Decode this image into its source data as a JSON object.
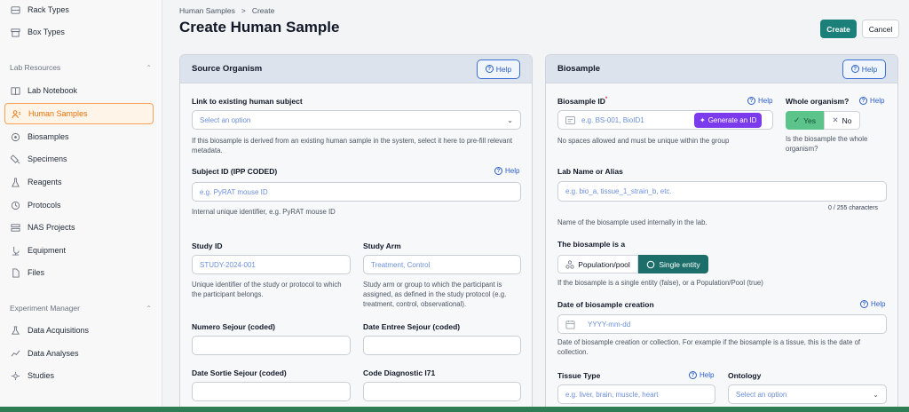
{
  "sidebar": {
    "items_top": [
      {
        "label": "Rack Types",
        "icon": "rack-icon"
      },
      {
        "label": "Box Types",
        "icon": "box-icon"
      }
    ],
    "section_lab": "Lab Resources",
    "lab_items": [
      {
        "label": "Lab Notebook",
        "icon": "book-icon"
      },
      {
        "label": "Human Samples",
        "icon": "person-icon"
      },
      {
        "label": "Biosamples",
        "icon": "biosample-icon"
      },
      {
        "label": "Specimens",
        "icon": "specimen-icon"
      },
      {
        "label": "Reagents",
        "icon": "flask-icon"
      },
      {
        "label": "Protocols",
        "icon": "protocol-icon"
      },
      {
        "label": "NAS Projects",
        "icon": "server-icon"
      },
      {
        "label": "Equipment",
        "icon": "equipment-icon"
      },
      {
        "label": "Files",
        "icon": "file-icon"
      }
    ],
    "section_exp": "Experiment Manager",
    "exp_items": [
      {
        "label": "Data Acquisitions",
        "icon": "acquisition-icon"
      },
      {
        "label": "Data Analyses",
        "icon": "analysis-icon"
      },
      {
        "label": "Studies",
        "icon": "studies-icon"
      }
    ],
    "active_item": "Human Samples"
  },
  "header": {
    "breadcrumb": [
      "Human Samples",
      ">",
      "Create"
    ],
    "title": "Create Human Sample",
    "create_label": "Create",
    "cancel_label": "Cancel"
  },
  "help_label": "Help",
  "source": {
    "title": "Source Organism",
    "link_label": "Link to existing human subject",
    "link_placeholder": "Select an option",
    "link_hint": "If this biosample is derived from an existing human sample in the system, select it here to pre-fill relevant metadata.",
    "subject_label": "Subject ID (IPP CODED)",
    "subject_placeholder": "e.g. PyRAT mouse ID",
    "subject_hint": "Internal unique identifier, e.g. PyRAT mouse ID",
    "study_id_label": "Study ID",
    "study_id_placeholder": "STUDY-2024-001",
    "study_id_hint": "Unique identifier of the study or protocol to which the participant belongs.",
    "study_arm_label": "Study Arm",
    "study_arm_placeholder": "Treatment, Control",
    "study_arm_hint": "Study arm or group to which the participant is assigned, as defined in the study protocol (e.g. treatment, control, observational).",
    "numero_label": "Numero Sejour (coded)",
    "date_entree_label": "Date Entree Sejour (coded)",
    "date_sortie_label": "Date Sortie Sejour (coded)",
    "code_diag_label": "Code Diagnostic I71"
  },
  "biosample": {
    "title": "Biosample",
    "id_label": "Biosample ID",
    "id_placeholder": "e.g. BS-001, BioID1",
    "generate_label": "Generate an ID",
    "id_hint": "No spaces allowed and must be unique within the group",
    "whole_label": "Whole organism?",
    "yes_label": "Yes",
    "no_label": "No",
    "whole_hint": "Is the biosample the whole organism?",
    "lab_name_label": "Lab Name or Alias",
    "lab_name_placeholder": "e.g. bio_a, tissue_1_strain_b, etc.",
    "char_count": "0 / 255 characters",
    "lab_name_hint": "Name of the biosample used internally in the lab.",
    "is_a_label": "The biosample is a",
    "population_label": "Population/pool",
    "single_label": "Single entity",
    "is_a_hint": "If the biosample is a single entity (false), or a Population/Pool (true)",
    "date_label": "Date of biosample creation",
    "date_placeholder": "YYYY-mm-dd",
    "date_hint": "Date of biosample creation or collection. For example if the biosample is a tissue, this is the date of collection.",
    "tissue_label": "Tissue Type",
    "tissue_placeholder": "e.g. liver, brain, muscle, heart",
    "ontology_label": "Ontology",
    "ontology_placeholder": "Select an option"
  },
  "colors": {
    "accent": "#1b7f7a",
    "active_orange": "#e8730a",
    "generate_purple": "#7c3aed",
    "help_blue": "#2b5fc7"
  }
}
